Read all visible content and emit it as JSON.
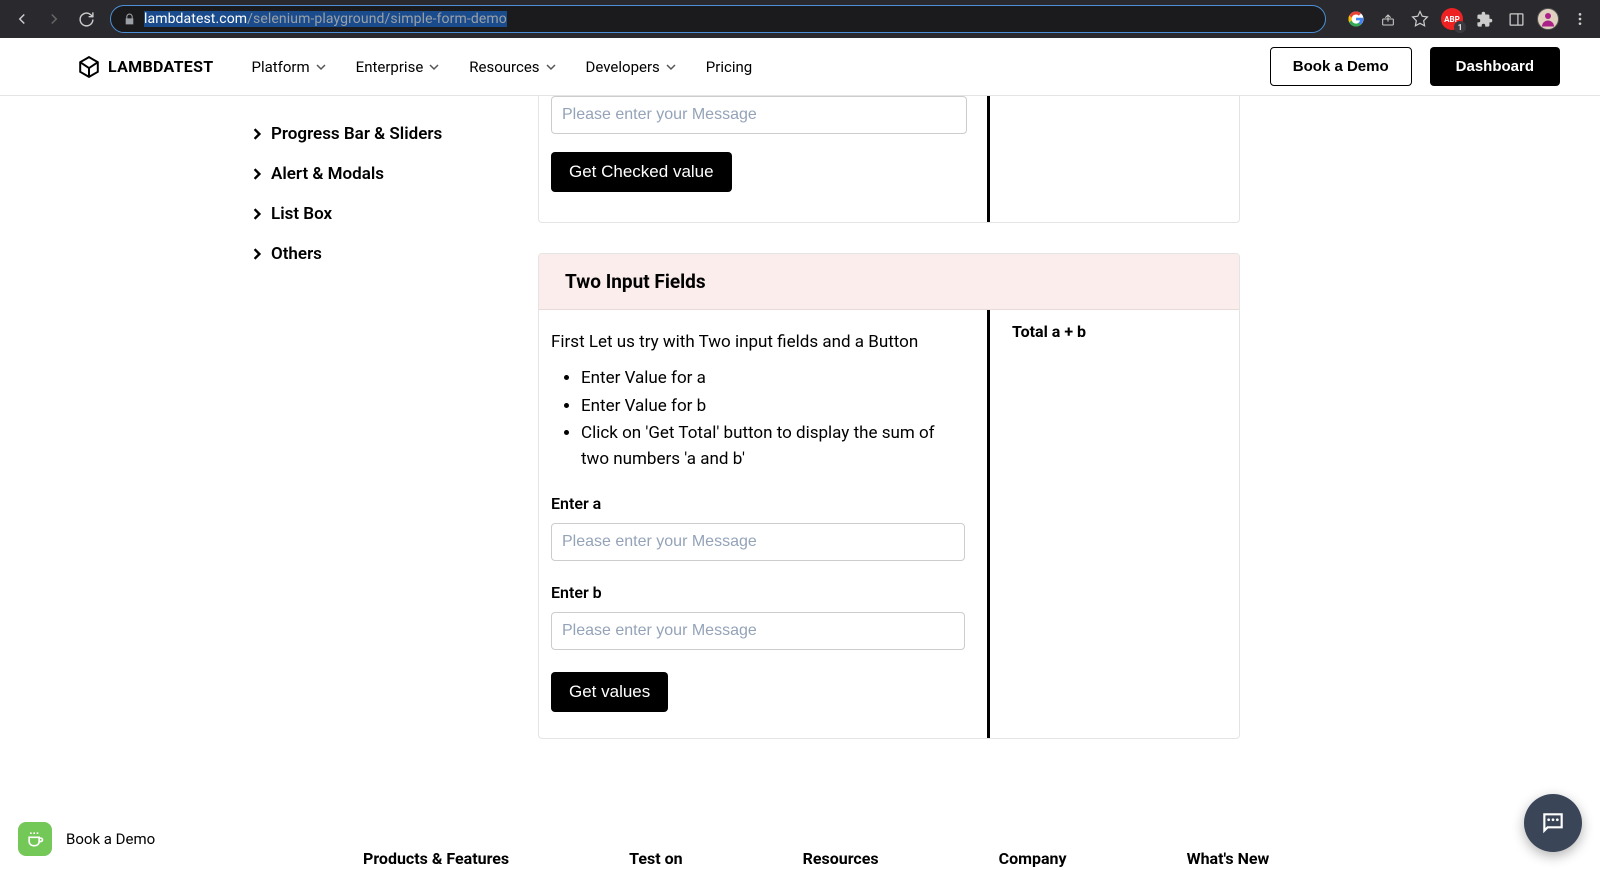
{
  "browser": {
    "url_host": "lambdatest.com",
    "url_path": "/selenium-playground/simple-form-demo",
    "abp_badge": "1"
  },
  "header": {
    "logo_text": "LAMBDATEST",
    "nav": [
      {
        "label": "Platform",
        "dropdown": true
      },
      {
        "label": "Enterprise",
        "dropdown": true
      },
      {
        "label": "Resources",
        "dropdown": true
      },
      {
        "label": "Developers",
        "dropdown": true
      },
      {
        "label": "Pricing",
        "dropdown": false
      }
    ],
    "book_demo": "Book a Demo",
    "dashboard": "Dashboard"
  },
  "sidebar": {
    "items": [
      {
        "label": "Progress Bar & Sliders"
      },
      {
        "label": "Alert & Modals"
      },
      {
        "label": "List Box"
      },
      {
        "label": "Others"
      }
    ]
  },
  "card1": {
    "input_placeholder": "Please enter your Message",
    "button_label": "Get Checked value"
  },
  "card2": {
    "header": "Two Input Fields",
    "intro": "First Let us try with Two input fields and a Button",
    "steps": [
      "Enter Value for a",
      "Enter Value for b",
      "Click on 'Get Total' button to display the sum of two numbers 'a and b'"
    ],
    "label_a": "Enter a",
    "label_b": "Enter b",
    "placeholder_a": "Please enter your Message",
    "placeholder_b": "Please enter your Message",
    "button_label": "Get values",
    "total_label": "Total a + b"
  },
  "footer": {
    "cols": [
      "Products & Features",
      "Test on",
      "Resources",
      "Company",
      "What's New"
    ]
  },
  "float": {
    "book_demo": "Book a Demo"
  }
}
